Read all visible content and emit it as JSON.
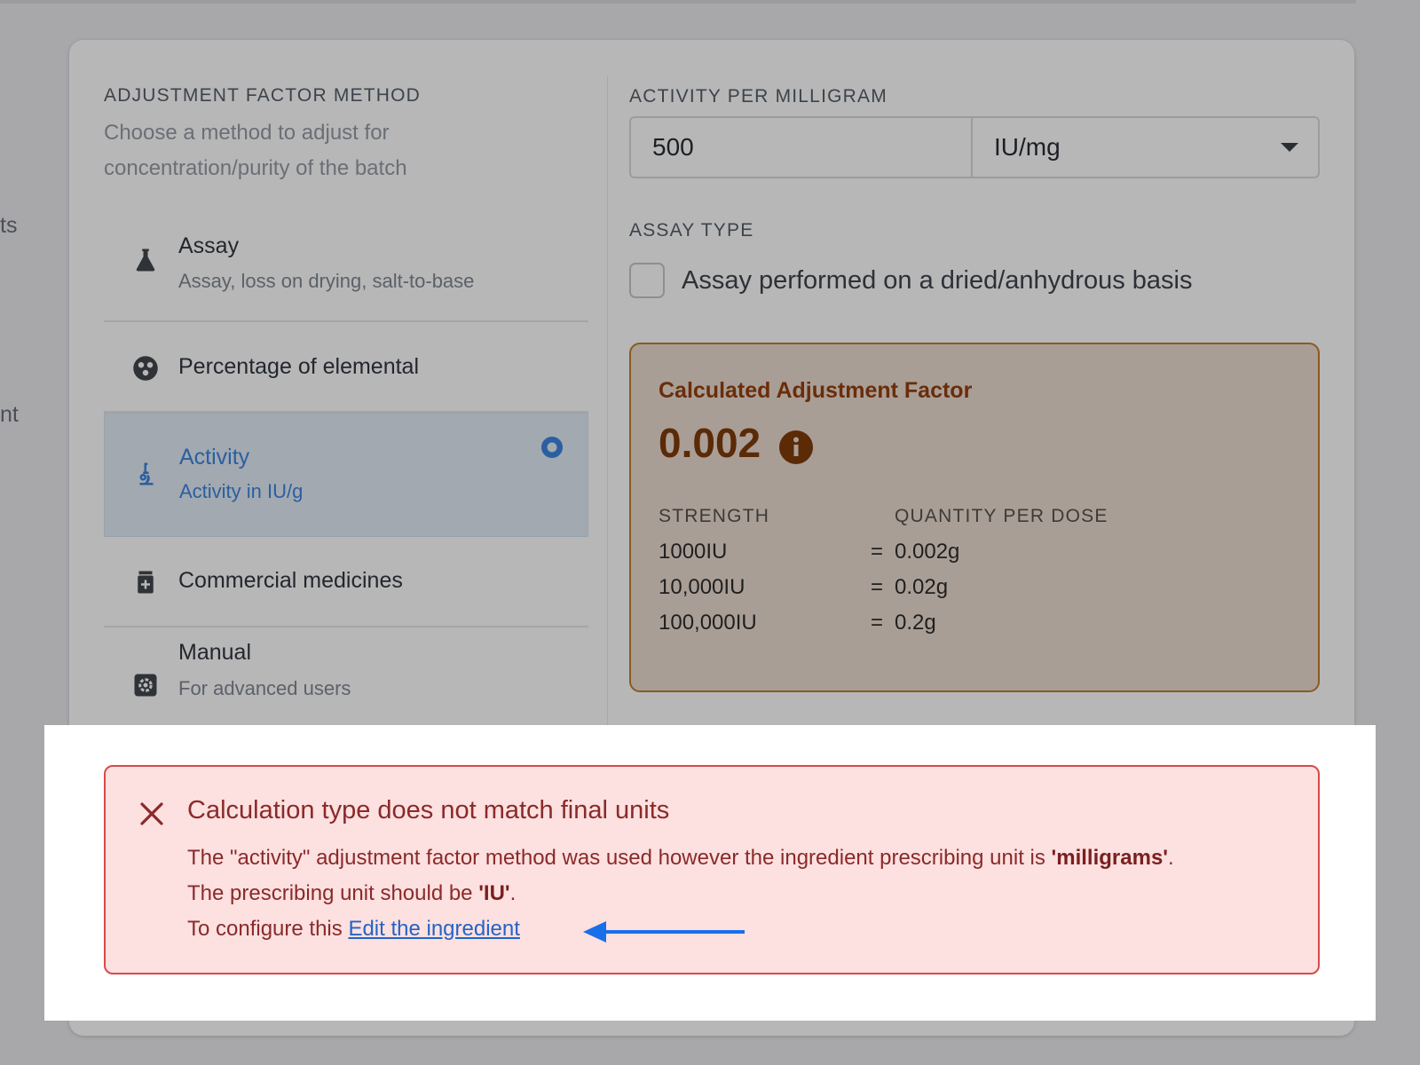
{
  "background": {
    "edge_text_1": "ts",
    "edge_text_2": "nt"
  },
  "adjustment": {
    "label": "ADJUSTMENT FACTOR METHOD",
    "description": "Choose a method to adjust for concentration/purity of the batch",
    "methods": [
      {
        "icon": "flask-icon",
        "title": "Assay",
        "subtitle": "Assay, loss on drying, salt-to-base",
        "selected": false
      },
      {
        "icon": "molecule-icon",
        "title": "Percentage of elemental",
        "subtitle": "",
        "selected": false
      },
      {
        "icon": "microscope-icon",
        "title": "Activity",
        "subtitle": "Activity in IU/g",
        "selected": true
      },
      {
        "icon": "medicine-bottle-icon",
        "title": "Commercial medicines",
        "subtitle": "",
        "selected": false
      },
      {
        "icon": "gear-icon",
        "title": "Manual",
        "subtitle": "For advanced users",
        "selected": false
      }
    ]
  },
  "activity": {
    "label": "ACTIVITY PER MILLIGRAM",
    "value": "500",
    "unit": "IU/mg"
  },
  "assay_type": {
    "label": "ASSAY TYPE",
    "checkbox_label": "Assay performed on a dried/anhydrous basis",
    "checked": false
  },
  "factor": {
    "title": "Calculated Adjustment Factor",
    "value": "0.002",
    "col_strength": "STRENGTH",
    "col_quantity": "QUANTITY PER DOSE",
    "rows": [
      {
        "strength": "1000IU",
        "eq": "=",
        "quantity": "0.002g"
      },
      {
        "strength": "10,000IU",
        "eq": "=",
        "quantity": "0.02g"
      },
      {
        "strength": "100,000IU",
        "eq": "=",
        "quantity": "0.2g"
      }
    ]
  },
  "alert": {
    "title": "Calculation type does not match final units",
    "line1_pre": "The \"activity\" adjustment factor method was used however the ingredient prescribing unit is ",
    "line1_bold": "'milligrams'",
    "line1_post": ".",
    "line2_pre": "The prescribing unit should be ",
    "line2_bold": "'IU'",
    "line2_post": ".",
    "line3_pre": "To configure this ",
    "link_text": "Edit the ingredient"
  },
  "colors": {
    "accent_blue": "#2a5fa0",
    "error_red": "#d94a4a",
    "arrow_blue": "#1a6fe8",
    "factor_brown": "#5b2a07"
  }
}
